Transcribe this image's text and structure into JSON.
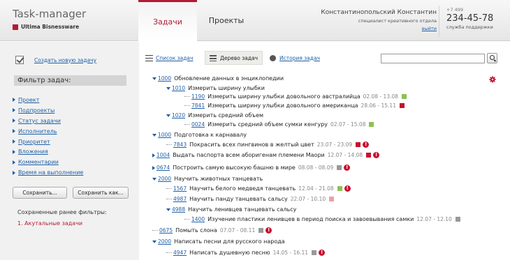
{
  "header": {
    "app_title": "Task-manager",
    "company": "Ultima Bisnessware",
    "tabs": [
      "Задачи",
      "Проекты"
    ],
    "user_name": "Константинопольский Константин",
    "user_role": "специалист креативного отдела",
    "logout": "выйти",
    "phone_code": "+7 499",
    "phone_number": "234-45-78",
    "support": "служба поддержки"
  },
  "sidebar": {
    "create_task": "Создать новую задачу",
    "filter_title": "Фильтр задач:",
    "filters": [
      "Проект",
      "Подпроекты",
      "Статус задачи",
      "Исполнитель",
      "Приоритет",
      "Вложения",
      "Комментарии",
      "Время на выполнение"
    ],
    "save_label": "Сохранить...",
    "save_as_label": "Сохранить как...",
    "saved_title": "Сохраненные ранее фильтры:",
    "saved_items": [
      "1. Акутальные задачи"
    ]
  },
  "views": {
    "list": "Список задач",
    "tree": "Дерево задач",
    "history": "История задач",
    "search_value": ""
  },
  "colors": {
    "accent": "#b31b34",
    "green": "#8cc152",
    "red": "#c8102e",
    "gray": "#999999",
    "pink": "#e8a0a8"
  },
  "tasks": [
    {
      "id": "1000",
      "title": "Обновление данных в энциклопедии",
      "date": "",
      "status": "",
      "warn": false
    },
    {
      "id": "1010",
      "title": "Измерить ширину улыбки",
      "date": "",
      "status": "",
      "warn": false
    },
    {
      "id": "1190",
      "title": "Измерить ширину улыбки довольного австралийца",
      "date": "02.08 - 13.08",
      "status": "green",
      "warn": false
    },
    {
      "id": "7841",
      "title": "Измерить ширину улыбки довольного американца",
      "date": "28.06 - 15.11",
      "status": "red",
      "warn": false
    },
    {
      "id": "1020",
      "title": "Измерить средний объем",
      "date": "",
      "status": "",
      "warn": false
    },
    {
      "id": "0024",
      "title": "Измерить средний объем сумки кенгуру",
      "date": "02.07 - 15.08",
      "status": "green",
      "warn": false
    },
    {
      "id": "1000",
      "title": "Подготовка к карнавалу",
      "date": "",
      "status": "",
      "warn": false
    },
    {
      "id": "7843",
      "title": "Покрасить всех пингвинов в желтый цвет",
      "date": "23.07 - 23.09",
      "status": "red",
      "warn": true
    },
    {
      "id": "1004",
      "title": "Выдать паспорта всем аборигенам племени Маори",
      "date": "12.07 - 14.08",
      "status": "red",
      "warn": true
    },
    {
      "id": "0674",
      "title": "Построить самую высокую башню в мире",
      "date": "08.08 - 08.09",
      "status": "gray",
      "warn": true
    },
    {
      "id": "2000",
      "title": "Научить животных танцевать",
      "date": "",
      "status": "",
      "warn": false
    },
    {
      "id": "1567",
      "title": "Научить белого медведя танцевать",
      "date": "12.04 - 21.08",
      "status": "green",
      "warn": true
    },
    {
      "id": "4987",
      "title": "Научить панду танцевать сальсу",
      "date": "22.07 - 10.10",
      "status": "pink",
      "warn": false
    },
    {
      "id": "4988",
      "title": "Научить ленивцев танцевать сальсу",
      "date": "",
      "status": "",
      "warn": false
    },
    {
      "id": "1400",
      "title": "Изучение пластики ленивцев в период поиска и завоевывания самки",
      "date": "12.07 - 12.10",
      "status": "gray",
      "warn": false
    },
    {
      "id": "0675",
      "title": "Помыть слона",
      "date": "07.07 - 08.11",
      "status": "gray",
      "warn": true
    },
    {
      "id": "2000",
      "title": "Написать песни для русского народа",
      "date": "",
      "status": "",
      "warn": false
    },
    {
      "id": "4947",
      "title": "Написать душевную песню",
      "date": "14.05 - 16.11",
      "status": "gray",
      "warn": true
    }
  ]
}
